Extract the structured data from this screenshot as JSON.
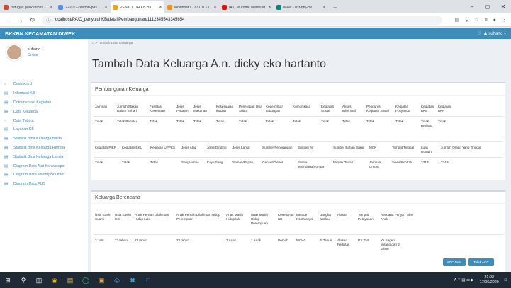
{
  "browser": {
    "tabs": [
      {
        "label": "petugas puskesmas - I",
        "color": "#db4437"
      },
      {
        "label": "222012-respon-pasang",
        "color": "#4f8ef7"
      },
      {
        "label": "PENYULUH KB BKKBN",
        "color": "#f4a300",
        "active": true
      },
      {
        "label": "localhost / 127.0.0.1 /",
        "color": "#f29111"
      },
      {
        "label": "(41) Murottal Merdu M",
        "color": "#ff0000"
      },
      {
        "label": "Meet - bzt-qhj-cw",
        "color": "#00897b"
      }
    ],
    "url": "localhost/PA/C_penyuluhKB/detailPembangunan/1112345543345654"
  },
  "header": {
    "brand": "BKKBN KECAMATAN DIWEK",
    "user": "suharto"
  },
  "sidebar": {
    "user": {
      "name": "suharto",
      "status": "Online"
    },
    "items": [
      "Dashboard",
      "Informasi KB",
      "Dokumentasi Kegiatan",
      "Data Keluarga",
      "Data Tribina",
      "Layanan KB",
      "Statistik Bina Keluarga Balita",
      "Statistik Bina Keluarga Remaja",
      "Statistik Bina Keluarga Lansia",
      "Diagram Data Alat Kontrasepsi",
      "Diagram Data Kelompok Umur",
      "Diagram Data PUS"
    ]
  },
  "breadcrumb": "Tambah Data Keluarga",
  "title": "Tambah Data Keluarga A.n. dicky eko hartanto",
  "pembangunan": {
    "title": "Pembangunan Keluarga",
    "row1_headers": [
      "Jaminan",
      "Jumlah Makan Dalam Sehari",
      "Fasilitas Kesehatan",
      "Jenis Pakaian",
      "Jenis Makanan",
      "Kesesuaian Ibadah",
      "Penerapan Usia Subur",
      "Kepemilikan Tabungan",
      "Komunikasi",
      "Kegiatan Sosial",
      "Akses Informasi",
      "Pengurus Kegiatan Sosial",
      "Kegiatan Posyandu",
      "Kegiatan BKB",
      "Kegiatan BKR"
    ],
    "row1_values": [
      "Tidak",
      "Tidak Berlaku",
      "Tidak",
      "Tidak",
      "Tidak",
      "Tidak",
      "Tidak",
      "Tidak",
      "Tidak",
      "Tidak",
      "Tidak",
      "Tidak",
      "Tidak",
      "Tidak Berlaku",
      "Tidak"
    ],
    "row2_headers": [
      "Kegiatan PIKR",
      "Kegiatan BKL",
      "Kegiatan UPPKS",
      "Jenis Atap",
      "Jenis Dinding",
      "Jenis Lantai",
      "Sumber Penerangan",
      "Sumber Air",
      "Sumber Bahan Bakar",
      "MCK",
      "Tempat Tinggal",
      "Luas Rumah",
      "Jumlah Orang Yang Tinggal"
    ],
    "row2_values": [
      "Tidak",
      "Tidak",
      "Tidak",
      "Seng/Asbes",
      "Kayu/Seng",
      "Semen/Papan",
      "Genset/Diesel",
      "Sumur Terlindung/Pompa",
      "Minyak Tanah",
      "Jamban Umum",
      "Sewa/Kontrak",
      "234 h",
      "234 h"
    ]
  },
  "kb": {
    "title": "Keluarga Berencana",
    "headers": [
      "Usia Kawin Suami",
      "Usia Kawin Istri",
      "Anak Pernah Dilahirkan Hidup Laki",
      "Anak Pernah Dilahirkan Hidup Perempuan",
      "Anak Masih Hidup laki",
      "Anak Masih Hidup Perempuan",
      "Keserta-an KB",
      "Metode Kontrasepsi",
      "Jangka Waktu",
      "Alasan",
      "Tempat Pelayanan",
      "Rencana Punya Anak",
      "Aksi"
    ],
    "values": [
      "2 Jam",
      "23 tahun",
      "23 tahun",
      "23 tahun",
      "3 Anak",
      "1 Anak",
      "Pernah",
      "MOW",
      "5 Tahun",
      "Alasan Fertilitas",
      "RS TNI",
      "Ya Segera kurang dari 2 tahun"
    ],
    "buttons": {
      "acc": "ACC Data",
      "tolak": "Tolak ACC"
    }
  },
  "taskbar": {
    "time": "21:02",
    "date": "17/06/2020"
  }
}
